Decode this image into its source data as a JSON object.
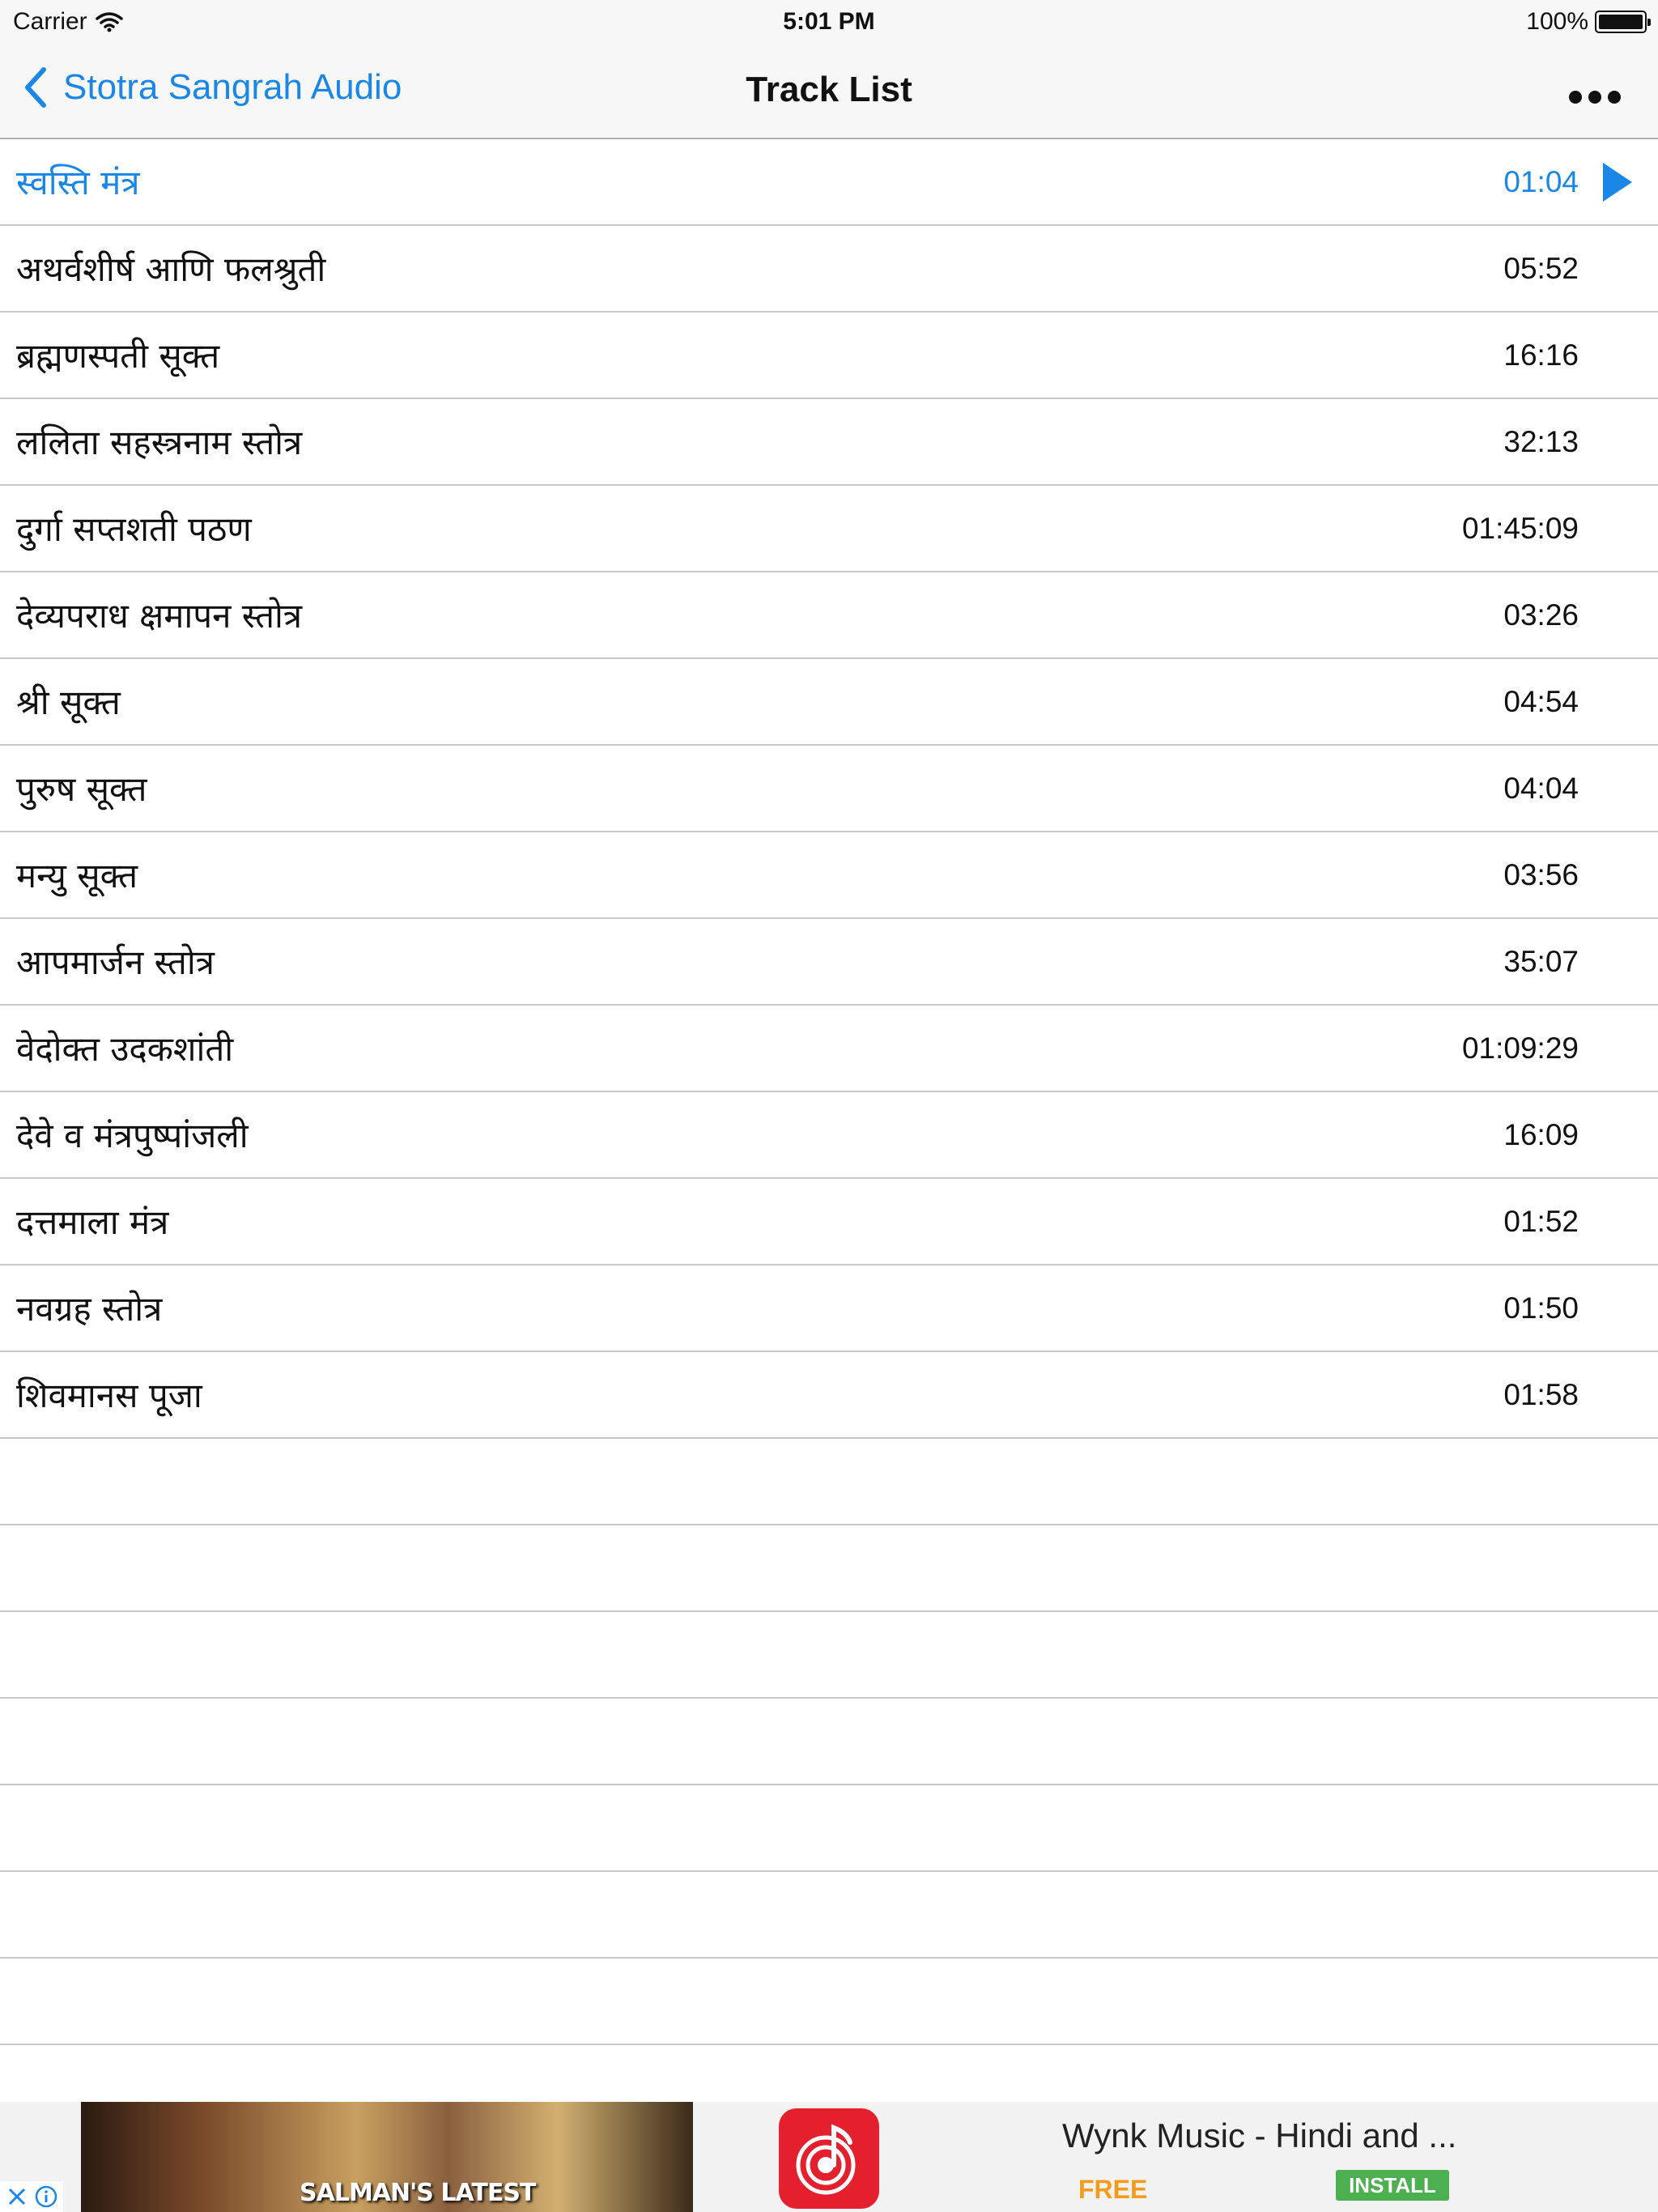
{
  "status_bar": {
    "carrier": "Carrier",
    "time": "5:01 PM",
    "battery": "100%"
  },
  "nav": {
    "back_label": "Stotra Sangrah Audio",
    "title": "Track List",
    "more_icon": "ellipsis-icon"
  },
  "accent_color": "#1a87e6",
  "tracks": [
    {
      "name": "स्वस्ति मंत्र",
      "duration": "01:04",
      "active": true
    },
    {
      "name": "अथर्वशीर्ष  आणि फलश्रुती",
      "duration": "05:52"
    },
    {
      "name": "ब्रह्मणस्पती सूक्त",
      "duration": "16:16"
    },
    {
      "name": "ललिता सहस्त्रनाम स्तोत्र",
      "duration": "32:13"
    },
    {
      "name": "दुर्गा सप्तशती पठण",
      "duration": "01:45:09"
    },
    {
      "name": "देव्यपराध  क्षमापन स्तोत्र",
      "duration": "03:26"
    },
    {
      "name": "श्री सूक्त",
      "duration": "04:54"
    },
    {
      "name": "पुरुष सूक्त",
      "duration": "04:04"
    },
    {
      "name": "मन्यु  सूक्त",
      "duration": "03:56"
    },
    {
      "name": "आपमार्जन स्तोत्र",
      "duration": "35:07"
    },
    {
      "name": "वेदोक्त उदकशांती",
      "duration": "01:09:29"
    },
    {
      "name": "देवे व मंत्रपुष्पांजली",
      "duration": "16:09"
    },
    {
      "name": "दत्तमाला मंत्र",
      "duration": "01:52"
    },
    {
      "name": "नवग्रह स्तोत्र",
      "duration": "01:50"
    },
    {
      "name": "शिवमानस  पूजा",
      "duration": "01:58"
    }
  ],
  "ad": {
    "image_caption": "SALMAN'S LATEST",
    "app_title": "Wynk Music - Hindi and ...",
    "price": "FREE",
    "install_label": "INSTALL"
  }
}
